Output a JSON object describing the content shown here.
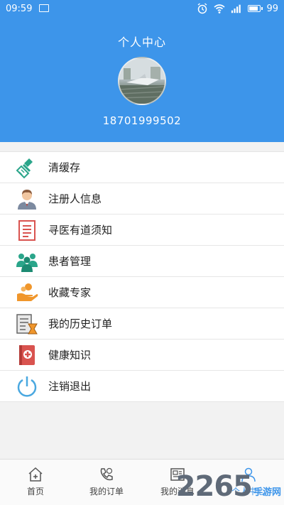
{
  "status_bar": {
    "time": "09:59",
    "battery_text": "99",
    "battery_level_percent": 99
  },
  "header": {
    "title": "个人中心",
    "phone": "18701999502"
  },
  "menu": {
    "items": [
      {
        "label": "清缓存",
        "icon": "broom-icon"
      },
      {
        "label": "注册人信息",
        "icon": "user-profile-icon"
      },
      {
        "label": "寻医有道须知",
        "icon": "document-list-icon"
      },
      {
        "label": "患者管理",
        "icon": "patients-group-icon"
      },
      {
        "label": "收藏专家",
        "icon": "hand-coin-icon"
      },
      {
        "label": "我的历史订单",
        "icon": "order-history-icon"
      },
      {
        "label": "健康知识",
        "icon": "medical-book-icon"
      },
      {
        "label": "注销退出",
        "icon": "power-icon"
      }
    ]
  },
  "bottom_nav": {
    "items": [
      {
        "label": "首页",
        "icon": "home-icon"
      },
      {
        "label": "我的订单",
        "icon": "phone-order-icon"
      },
      {
        "label": "我的消息",
        "icon": "message-icon"
      },
      {
        "label": "个人中心",
        "icon": "person-icon",
        "active": true
      }
    ]
  },
  "watermark": {
    "number": "2265",
    "text": "手游网"
  },
  "colors": {
    "header_blue": "#3d95ea",
    "icon_green": "#2aa58a",
    "icon_red": "#d9534f",
    "icon_orange": "#f0962b",
    "power_blue": "#4aa8e0"
  }
}
